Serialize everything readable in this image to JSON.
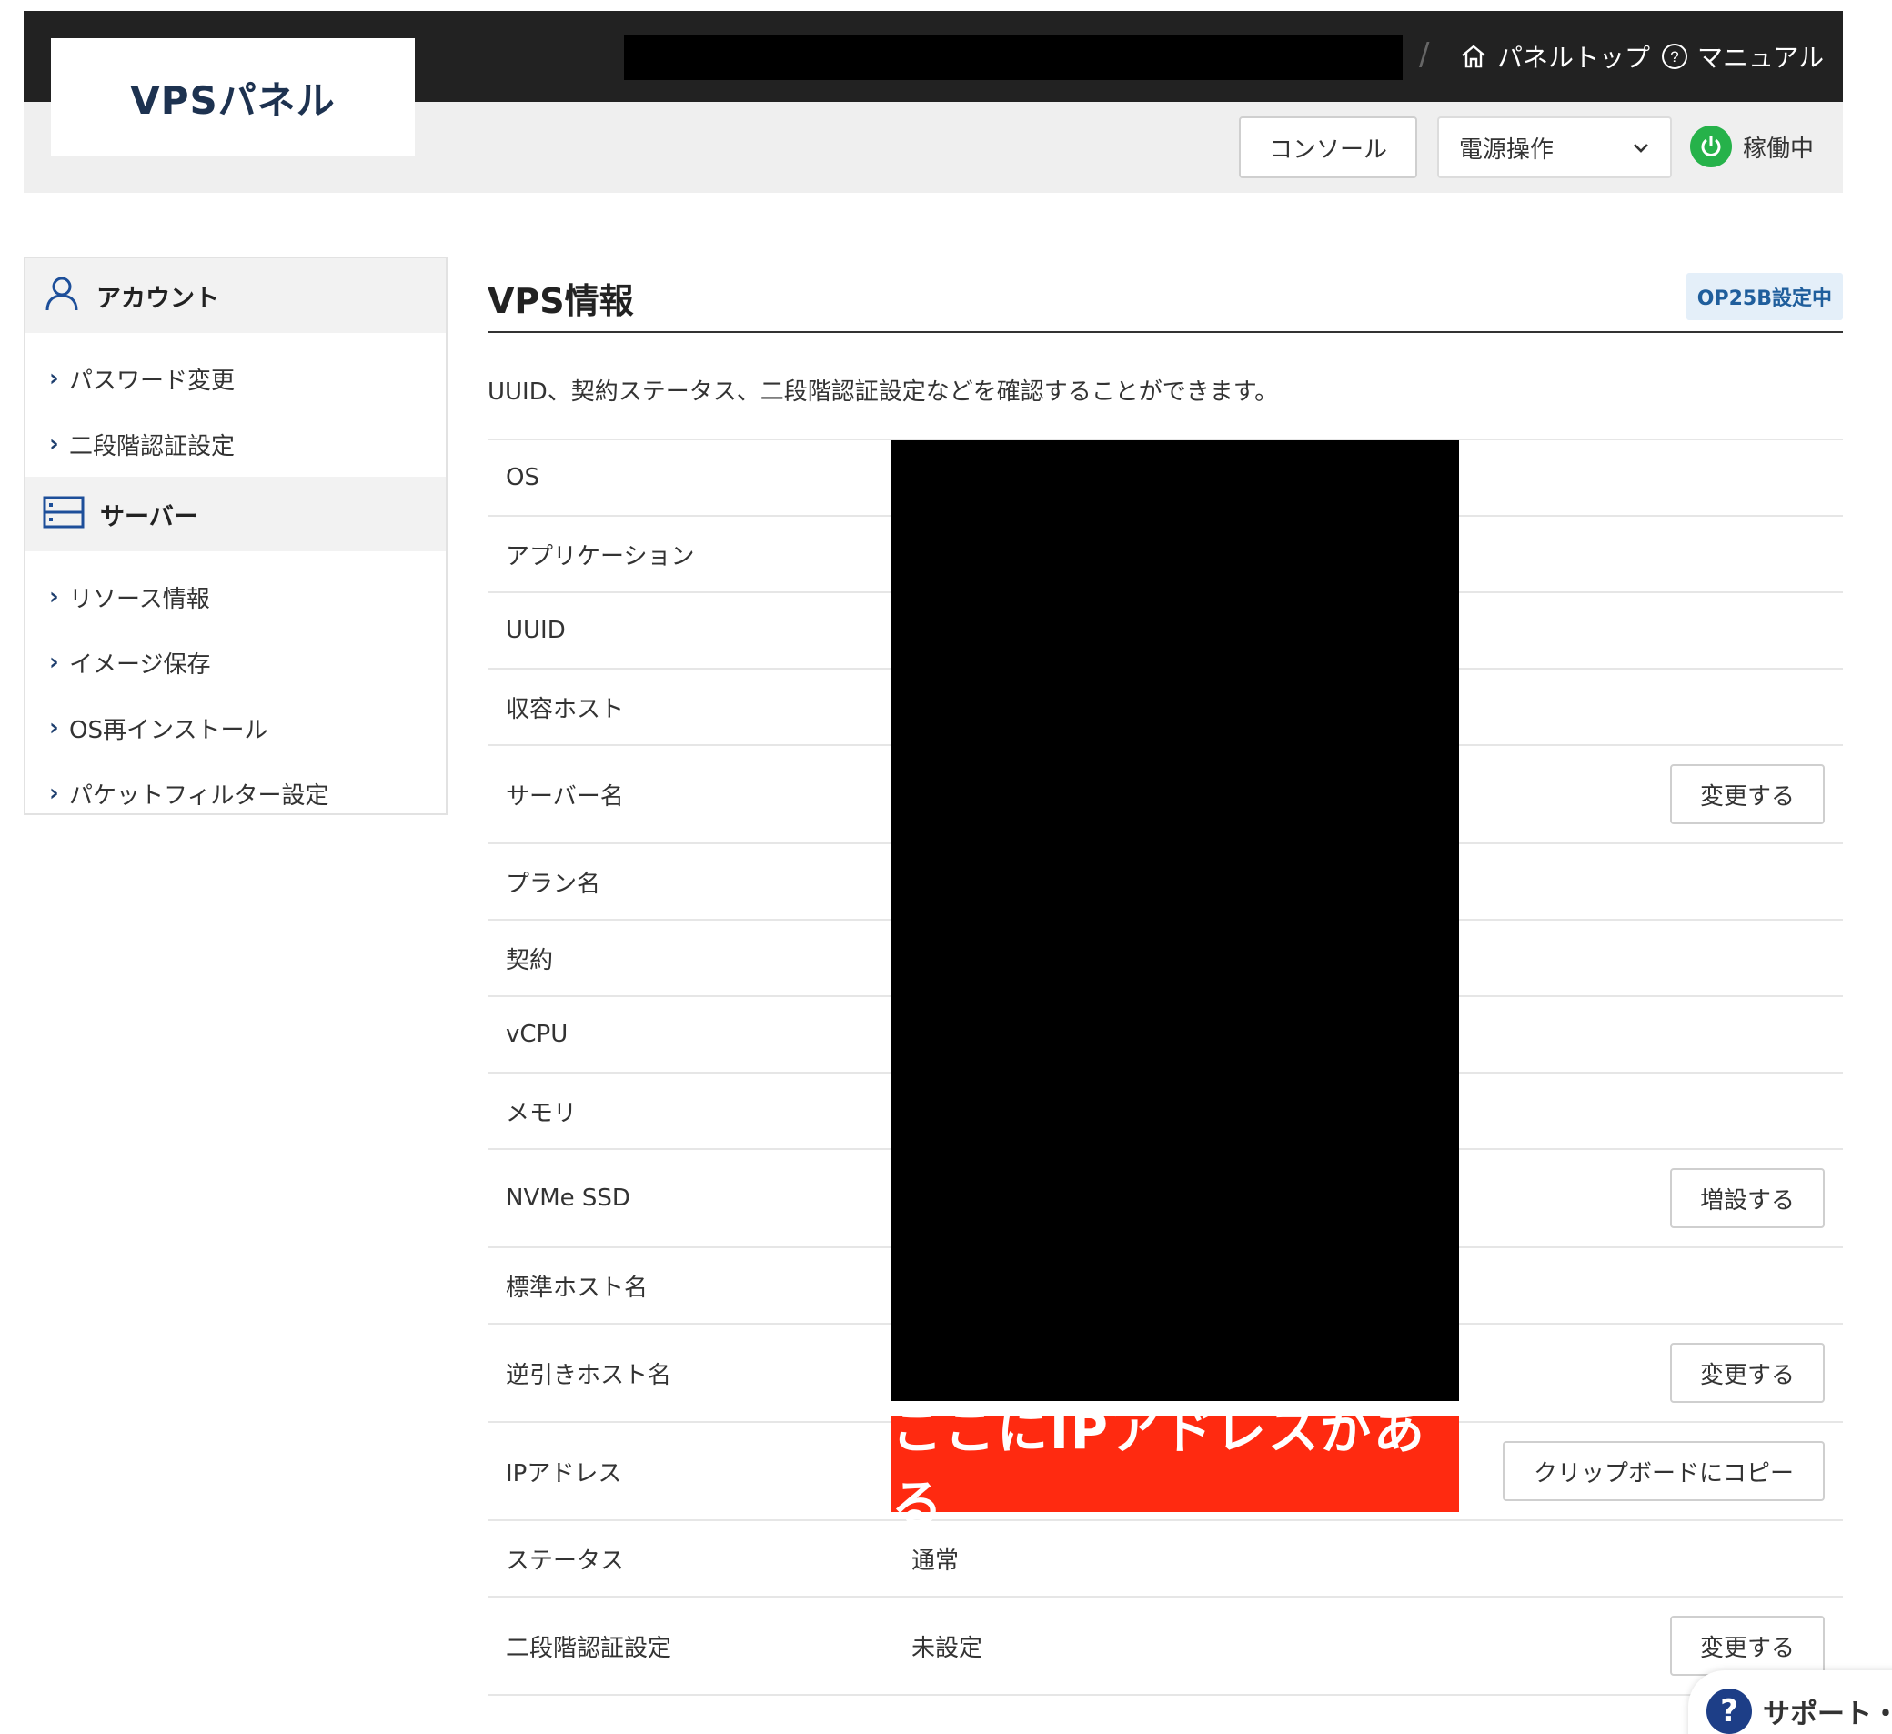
{
  "header": {
    "logo": "VPSパネル",
    "nav_top": "パネルトップ",
    "nav_manual": "マニュアル",
    "separator": "/",
    "console_button": "コンソール",
    "power_select": "電源操作",
    "status": "稼働中",
    "colors": {
      "topbar": "#222222",
      "status": "#26b24a"
    }
  },
  "sidebar": {
    "sections": [
      {
        "title": "アカウント",
        "icon": "user-icon",
        "items": [
          "パスワード変更",
          "二段階認証設定"
        ]
      },
      {
        "title": "サーバー",
        "icon": "server-icon",
        "items": [
          "リソース情報",
          "イメージ保存",
          "OS再インストール",
          "パケットフィルター設定"
        ]
      }
    ]
  },
  "main": {
    "title": "VPS情報",
    "badge": "OP25B設定中",
    "description": "UUID、契約ステータス、二段階認証設定などを確認することができます。",
    "rows": [
      {
        "label": "OS",
        "value": "",
        "button": ""
      },
      {
        "label": "アプリケーション",
        "value": "",
        "button": ""
      },
      {
        "label": "UUID",
        "value": "",
        "button": ""
      },
      {
        "label": "収容ホスト",
        "value": "",
        "button": ""
      },
      {
        "label": "サーバー名",
        "value": "",
        "button": "変更する"
      },
      {
        "label": "プラン名",
        "value": "",
        "button": ""
      },
      {
        "label": "契約",
        "value": "",
        "button": ""
      },
      {
        "label": "vCPU",
        "value": "",
        "button": ""
      },
      {
        "label": "メモリ",
        "value": "",
        "button": ""
      },
      {
        "label": "NVMe SSD",
        "value": "",
        "button": "増設する"
      },
      {
        "label": "標準ホスト名",
        "value": "",
        "button": ""
      },
      {
        "label": "逆引きホスト名",
        "value": "",
        "button": "変更する"
      },
      {
        "label": "IPアドレス",
        "value": "",
        "button": "クリップボードにコピー"
      },
      {
        "label": "ステータス",
        "value": "通常",
        "button": ""
      },
      {
        "label": "二段階認証設定",
        "value": "未設定",
        "button": "変更する"
      }
    ],
    "ip_annotation": "ここにIPアドレスがある",
    "colors": {
      "annotation": "#ff2a10",
      "badge_bg": "#e4eff9",
      "badge_text": "#1f5e9c"
    }
  },
  "support": {
    "label": "サポート・",
    "icon": "question-icon"
  }
}
